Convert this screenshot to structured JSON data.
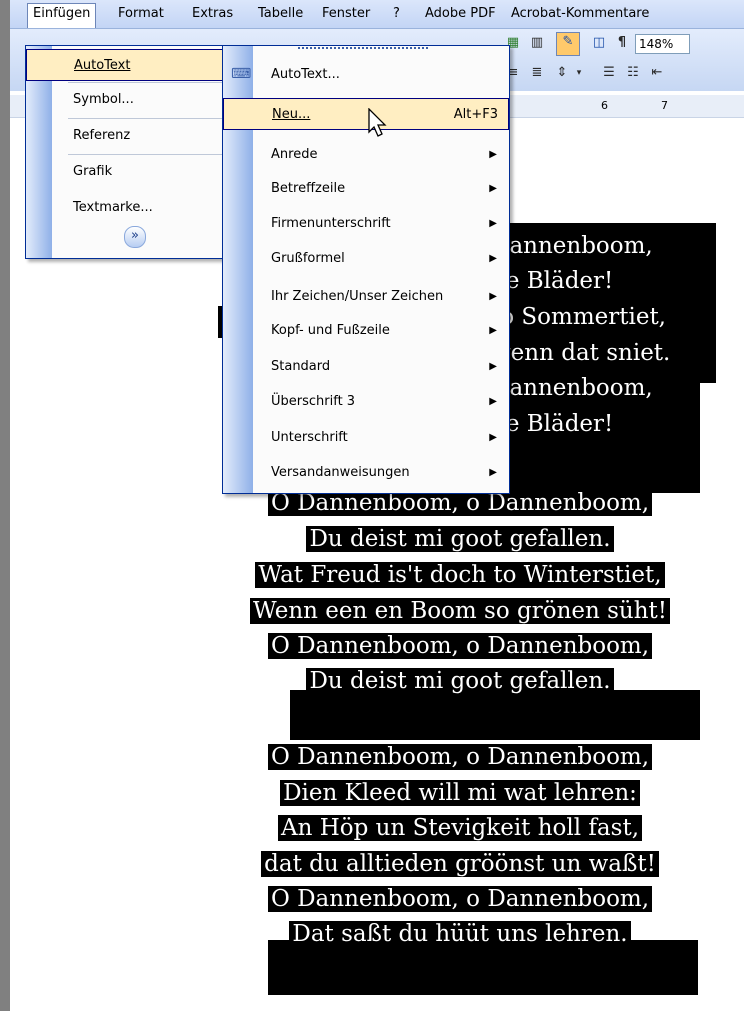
{
  "menubar": {
    "items": [
      {
        "label": "Einfügen",
        "active": true
      },
      {
        "label": "Format"
      },
      {
        "label": "Extras"
      },
      {
        "label": "Tabelle"
      },
      {
        "label": "Fenster"
      },
      {
        "label": "?"
      },
      {
        "label": "Adobe PDF"
      },
      {
        "label": "Acrobat-Kommentare"
      }
    ]
  },
  "toolbar": {
    "zoom": "148%",
    "icons": [
      "table-insert-icon",
      "columns-icon",
      "drawing-icon",
      "document-map-icon",
      "paragraph-mark-icon"
    ]
  },
  "ruler": {
    "marks": [
      "6",
      "7"
    ]
  },
  "insert_menu": {
    "items": [
      {
        "label": "AutoText",
        "submenu": true,
        "highlighted": true
      },
      {
        "label": "Symbol...",
        "submenu": false
      },
      {
        "label": "Referenz",
        "submenu": true
      },
      {
        "label": "Grafik",
        "submenu": true
      },
      {
        "label": "Textmarke...",
        "submenu": false
      }
    ],
    "expand_glyph": "»"
  },
  "autotext_submenu": {
    "items": [
      {
        "label": "AutoText...",
        "shortcut": "",
        "submenu": false
      },
      {
        "label": "Neu...",
        "shortcut": "Alt+F3",
        "submenu": false,
        "highlighted": true
      },
      {
        "label": "Anrede",
        "submenu": true
      },
      {
        "label": "Betreffzeile",
        "submenu": true
      },
      {
        "label": "Firmenunterschrift",
        "submenu": true
      },
      {
        "label": "Grußformel",
        "submenu": true
      },
      {
        "label": "Ihr Zeichen/Unser Zeichen",
        "submenu": true
      },
      {
        "label": "Kopf- und Fußzeile",
        "submenu": true
      },
      {
        "label": "Standard",
        "submenu": true
      },
      {
        "label": "Überschrift 3",
        "submenu": true
      },
      {
        "label": "Unterschrift",
        "submenu": true
      },
      {
        "label": "Versandanweisungen",
        "submenu": true
      }
    ]
  },
  "document": {
    "visible_lines_top": [
      "Dannenboom,",
      "ne Bläder!",
      "to Sommertiet,",
      "wenn dat sniet.",
      "Dannenboom,",
      "ne Bläder!"
    ],
    "stanza2": [
      "O Dannenboom, o Dannenboom,",
      "Du deist mi goot gefallen.",
      "Wat Freud is't doch to Winterstiet,",
      "Wenn een en Boom so grönen süht!",
      "O Dannenboom, o Dannenboom,",
      "Du deist mi goot gefallen."
    ],
    "stanza3": [
      "O Dannenboom, o Dannenboom,",
      "Dien Kleed will mi wat lehren:",
      "An Höp un Stevigkeit holl fast,",
      "dat du alltieden gröönst un waßt!",
      "O Dannenboom, o Dannenboom,",
      "Dat saßt du hüüt uns lehren."
    ]
  }
}
